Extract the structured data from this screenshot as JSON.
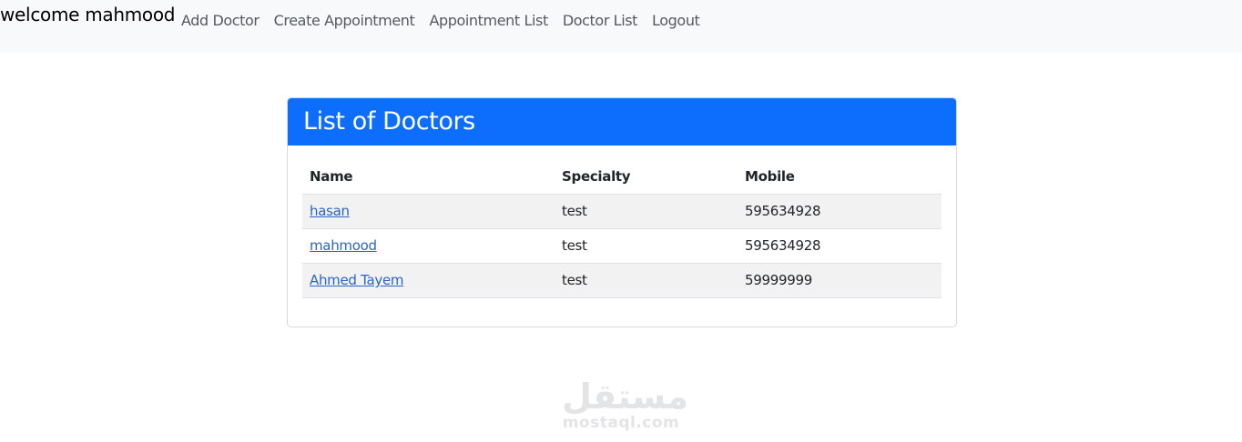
{
  "navbar": {
    "brand": "welcome mahmood",
    "links": [
      {
        "label": "Add Doctor"
      },
      {
        "label": "Create Appointment"
      },
      {
        "label": "Appointment List"
      },
      {
        "label": "Doctor List"
      },
      {
        "label": "Logout"
      }
    ]
  },
  "card": {
    "title": "List of Doctors",
    "columns": [
      "Name",
      "Specialty",
      "Mobile"
    ],
    "rows": [
      {
        "name": "hasan",
        "specialty": "test",
        "mobile": "595634928"
      },
      {
        "name": "mahmood",
        "specialty": "test",
        "mobile": "595634928"
      },
      {
        "name": "Ahmed Tayem",
        "specialty": "test",
        "mobile": "59999999"
      }
    ]
  },
  "watermark": {
    "arabic": "مستقل",
    "latin": "mostaql.com"
  },
  "colors": {
    "header_bg": "#0d6efd",
    "navbar_bg": "#f8f9fa",
    "link": "#2c64c4"
  }
}
